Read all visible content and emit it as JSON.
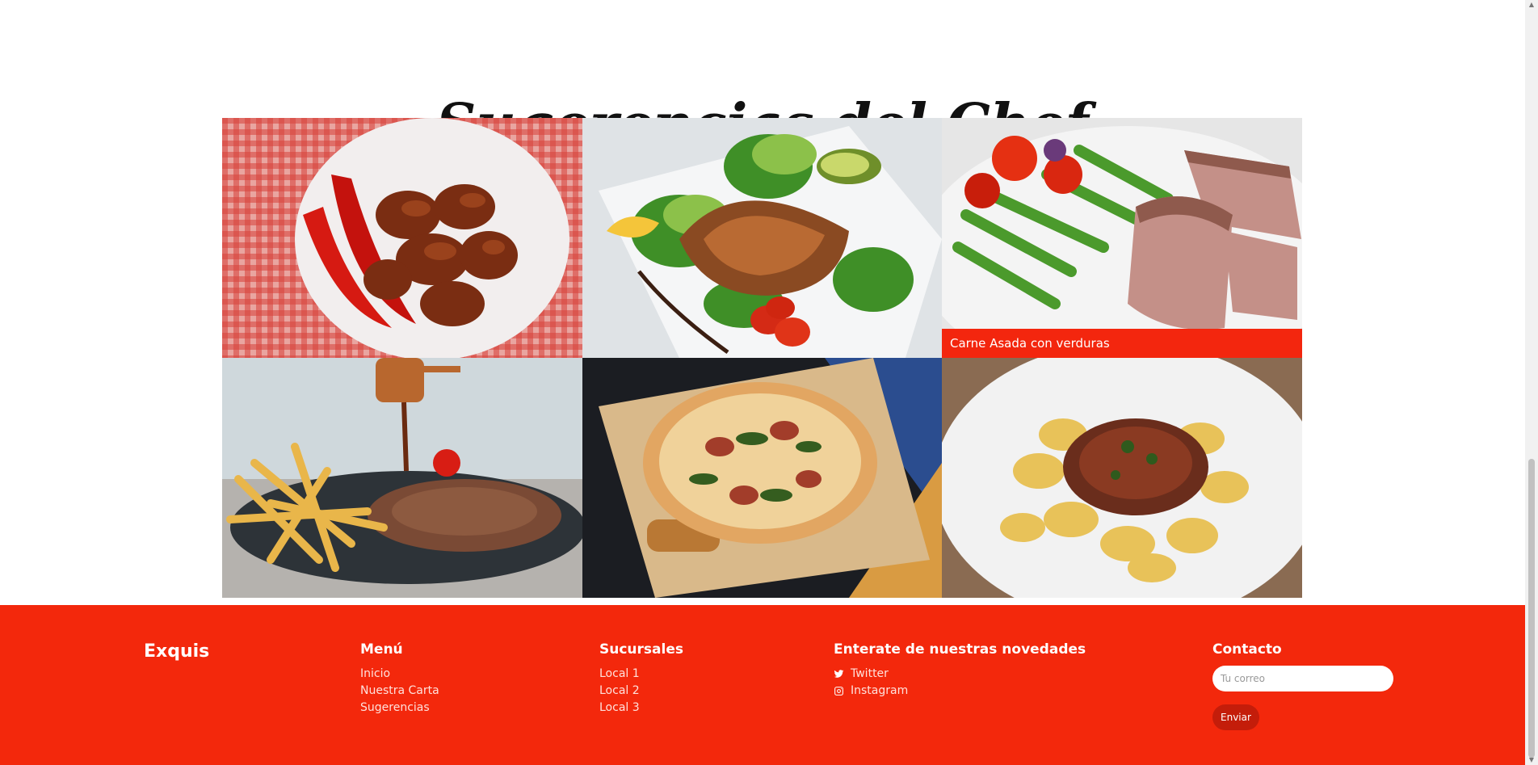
{
  "section": {
    "title": "Sugerencias del Chef"
  },
  "gallery": [
    {
      "caption": "",
      "image": "chicken-wings-chili"
    },
    {
      "caption": "",
      "image": "grilled-salmon-salad"
    },
    {
      "caption": "Carne Asada con verduras",
      "image": "steak-asparagus"
    },
    {
      "caption": "",
      "image": "steak-fries-sauce"
    },
    {
      "caption": "",
      "image": "pizza-board"
    },
    {
      "caption": "",
      "image": "tortellini-sauce"
    }
  ],
  "footer": {
    "brand": "Exquis",
    "menu": {
      "title": "Menú",
      "items": [
        "Inicio",
        "Nuestra Carta",
        "Sugerencias"
      ]
    },
    "branches": {
      "title": "Sucursales",
      "items": [
        "Local 1",
        "Local 2",
        "Local 3"
      ]
    },
    "news": {
      "title": "Enterate de nuestras novedades",
      "twitter": "Twitter",
      "instagram": "Instagram"
    },
    "contact": {
      "title": "Contacto",
      "placeholder": "Tu correo",
      "button": "Enviar"
    }
  },
  "colors": {
    "accent": "#f3280c",
    "button": "#c41d0a"
  }
}
